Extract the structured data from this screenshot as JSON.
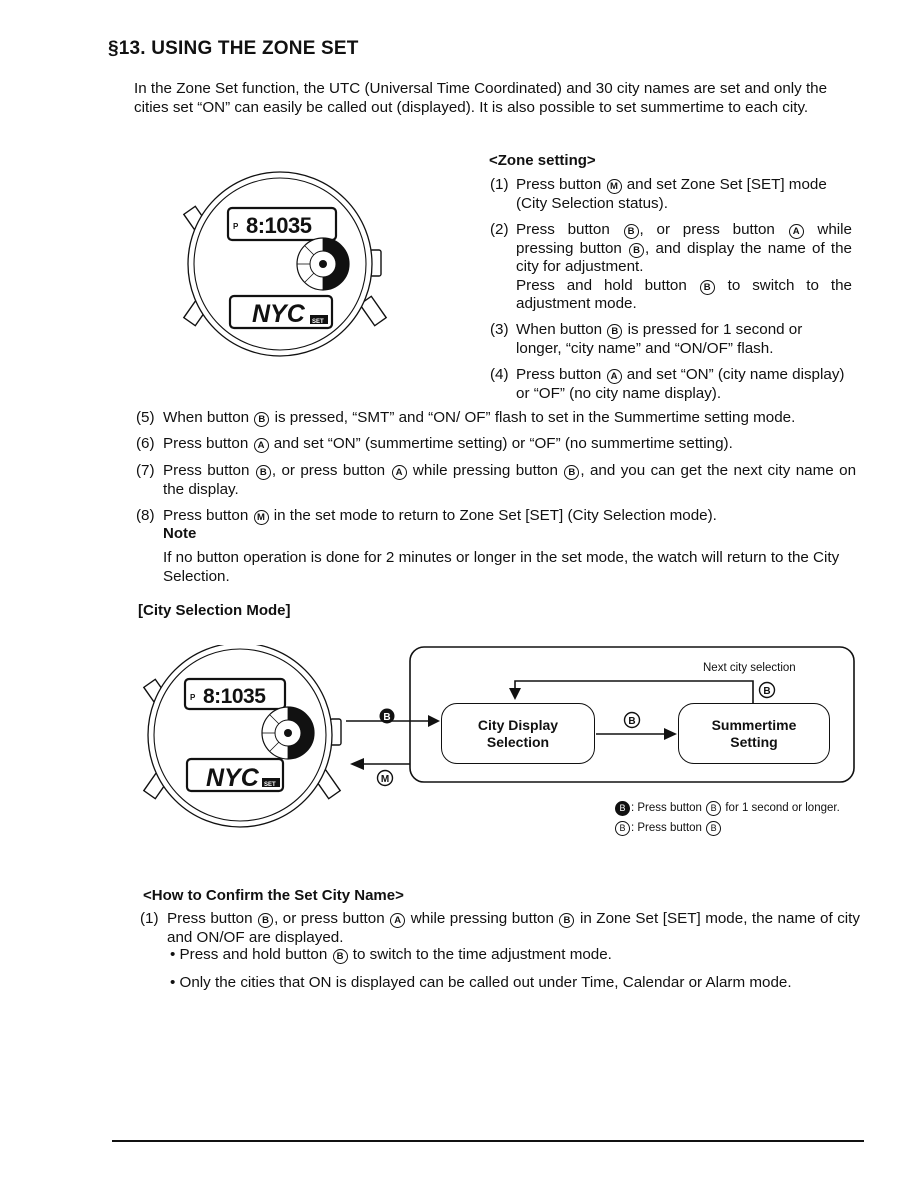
{
  "section": {
    "title": "§13. USING THE ZONE SET",
    "intro": "In the Zone Set function, the UTC (Universal Time Coordinated) and 30 city names are set and only the cities set “ON” can easily be called out (displayed). It is also possible to set summertime to each city."
  },
  "watch": {
    "top_display_prefix": "P",
    "top_display_time": "8:1035",
    "bottom_display_city": "NYC",
    "bottom_display_tag": "SET"
  },
  "zone_setting": {
    "heading": "<Zone setting>",
    "steps": [
      {
        "num": "(1)",
        "parts": [
          "Press button ",
          "M",
          " and set Zone Set [SET] mode (City Selection status)."
        ]
      },
      {
        "num": "(2)",
        "parts": [
          "Press button ",
          "B",
          ", or press button ",
          "A",
          " while pressing button ",
          "B",
          ", and display the name of the city for adjustment."
        ],
        "extra_parts": [
          "Press and hold button ",
          "B",
          " to switch to the adjustment mode."
        ]
      },
      {
        "num": "(3)",
        "parts": [
          "When button ",
          "B",
          " is pressed for 1 second or longer, “city name” and “ON/OF” flash."
        ]
      },
      {
        "num": "(4)",
        "parts": [
          "Press button ",
          "A",
          " and set “ON” (city name display) or “OF” (no city name display)."
        ]
      },
      {
        "num": "(5)",
        "parts": [
          "When button ",
          "B",
          " is pressed, “SMT” and “ON/ OF” flash to set in the Summertime setting mode."
        ]
      },
      {
        "num": "(6)",
        "parts": [
          "Press button ",
          "A",
          " and set “ON” (summertime setting) or “OF” (no summertime setting)."
        ]
      },
      {
        "num": "(7)",
        "parts": [
          "Press button ",
          "B",
          ", or press button ",
          "A",
          " while pressing button ",
          "B",
          ", and you can get the next city name on the display."
        ]
      },
      {
        "num": "(8)",
        "parts": [
          "Press button ",
          "M",
          " in the set mode to return to Zone Set [SET] (City Selection mode)."
        ]
      }
    ],
    "note_label": "Note",
    "note_text": "If no button operation is done for 2 minutes or longer in the set mode, the watch will return to the City Selection."
  },
  "city_selection_mode": {
    "heading": "[City Selection Mode]",
    "diagram": {
      "node_city_display": "City Display\nSelection",
      "node_city_display_l1": "City Display",
      "node_city_display_l2": "Selection",
      "node_summertime_l1": "Summertime",
      "node_summertime_l2": "Setting",
      "loop_label": "Next city selection",
      "arrow_enter_button": "B",
      "arrow_exit_button": "M",
      "arrow_middle_button": "B",
      "arrow_loop_button": "B"
    },
    "legend": [
      {
        "symbol": "B",
        "style": "filled",
        "text_before": ": Press button ",
        "symbol2": "B",
        "text_after": " for 1 second or longer."
      },
      {
        "symbol": "B",
        "style": "outline",
        "text_before": ": Press button ",
        "symbol2": "B",
        "text_after": ""
      }
    ]
  },
  "confirm": {
    "heading": "<How to Confirm the Set City Name>",
    "step_num": "(1)",
    "step_parts": [
      "Press button ",
      "B",
      ", or press button ",
      "A",
      " while pressing button ",
      "B",
      " in Zone Set [SET] mode, the name of city and ON/OF are displayed."
    ],
    "bullets": [
      {
        "parts": [
          "Press and hold button ",
          "B",
          " to switch to the time adjustment mode."
        ]
      },
      {
        "parts": [
          "Only the cities that ON is displayed can be called out under Time, Calendar or Alarm mode."
        ]
      }
    ]
  }
}
